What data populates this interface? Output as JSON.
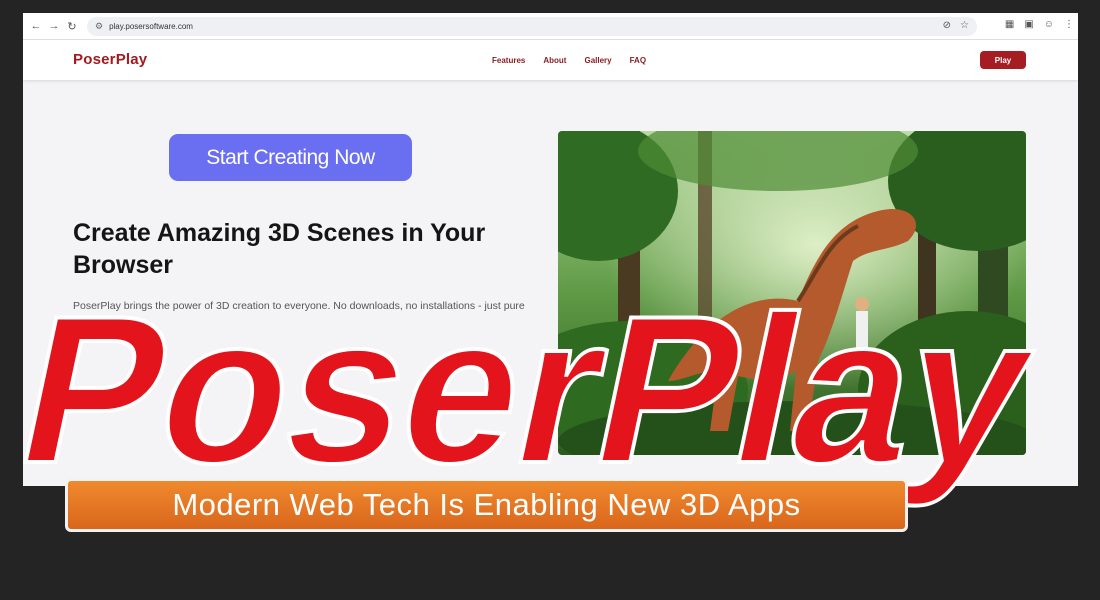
{
  "browser": {
    "url": "play.posersoftware.com"
  },
  "site": {
    "brand": "PoserPlay",
    "nav": [
      "Features",
      "About",
      "Gallery",
      "FAQ"
    ],
    "play_label": "Play"
  },
  "hero": {
    "cta_label": "Start Creating Now",
    "title": "Create Amazing 3D Scenes in Your Browser",
    "text": "PoserPlay brings the power of 3D creation to everyone. No downloads, no installations - just pure creativity."
  },
  "overlay": {
    "wordmark": "PoserPlay",
    "banner": "Modern Web Tech Is Enabling New 3D Apps"
  },
  "colors": {
    "brand_red": "#a31a20",
    "cta_purple": "#6a6ff2",
    "wordmark_red": "#e3141b",
    "banner_orange": "#e3731f"
  }
}
